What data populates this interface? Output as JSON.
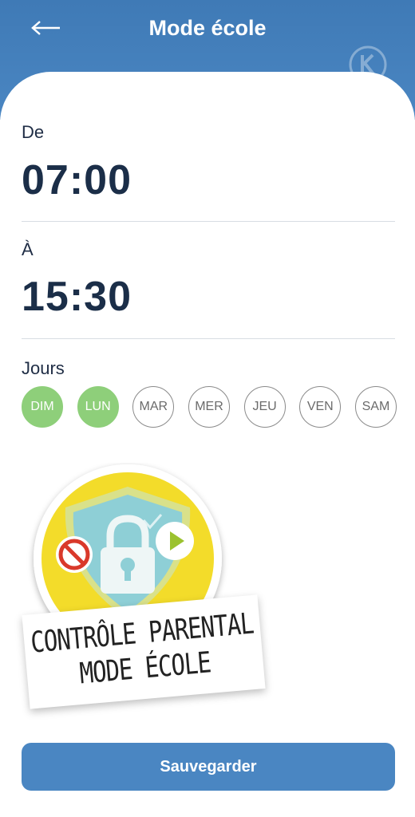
{
  "header": {
    "title": "Mode école",
    "back_icon": "arrow-left-icon",
    "brand_icon": "k-logo-icon"
  },
  "from": {
    "label": "De",
    "time": "07:00"
  },
  "to": {
    "label": "À",
    "time": "15:30"
  },
  "days": {
    "label": "Jours",
    "items": [
      {
        "label": "DIM",
        "selected": true
      },
      {
        "label": "LUN",
        "selected": true
      },
      {
        "label": "MAR",
        "selected": false
      },
      {
        "label": "MER",
        "selected": false
      },
      {
        "label": "JEU",
        "selected": false
      },
      {
        "label": "VEN",
        "selected": false
      },
      {
        "label": "SAM",
        "selected": false
      }
    ]
  },
  "illustration": {
    "line1": "CONTRÔLE PARENTAL",
    "line2": "MODE ÉCOLE",
    "icons": [
      "shield-lock-icon",
      "forbidden-icon",
      "play-icon"
    ]
  },
  "save": {
    "label": "Sauvegarder"
  },
  "colors": {
    "primary": "#4a86c2",
    "selected_day": "#8ecf7a",
    "text_dark": "#1b2e48"
  }
}
